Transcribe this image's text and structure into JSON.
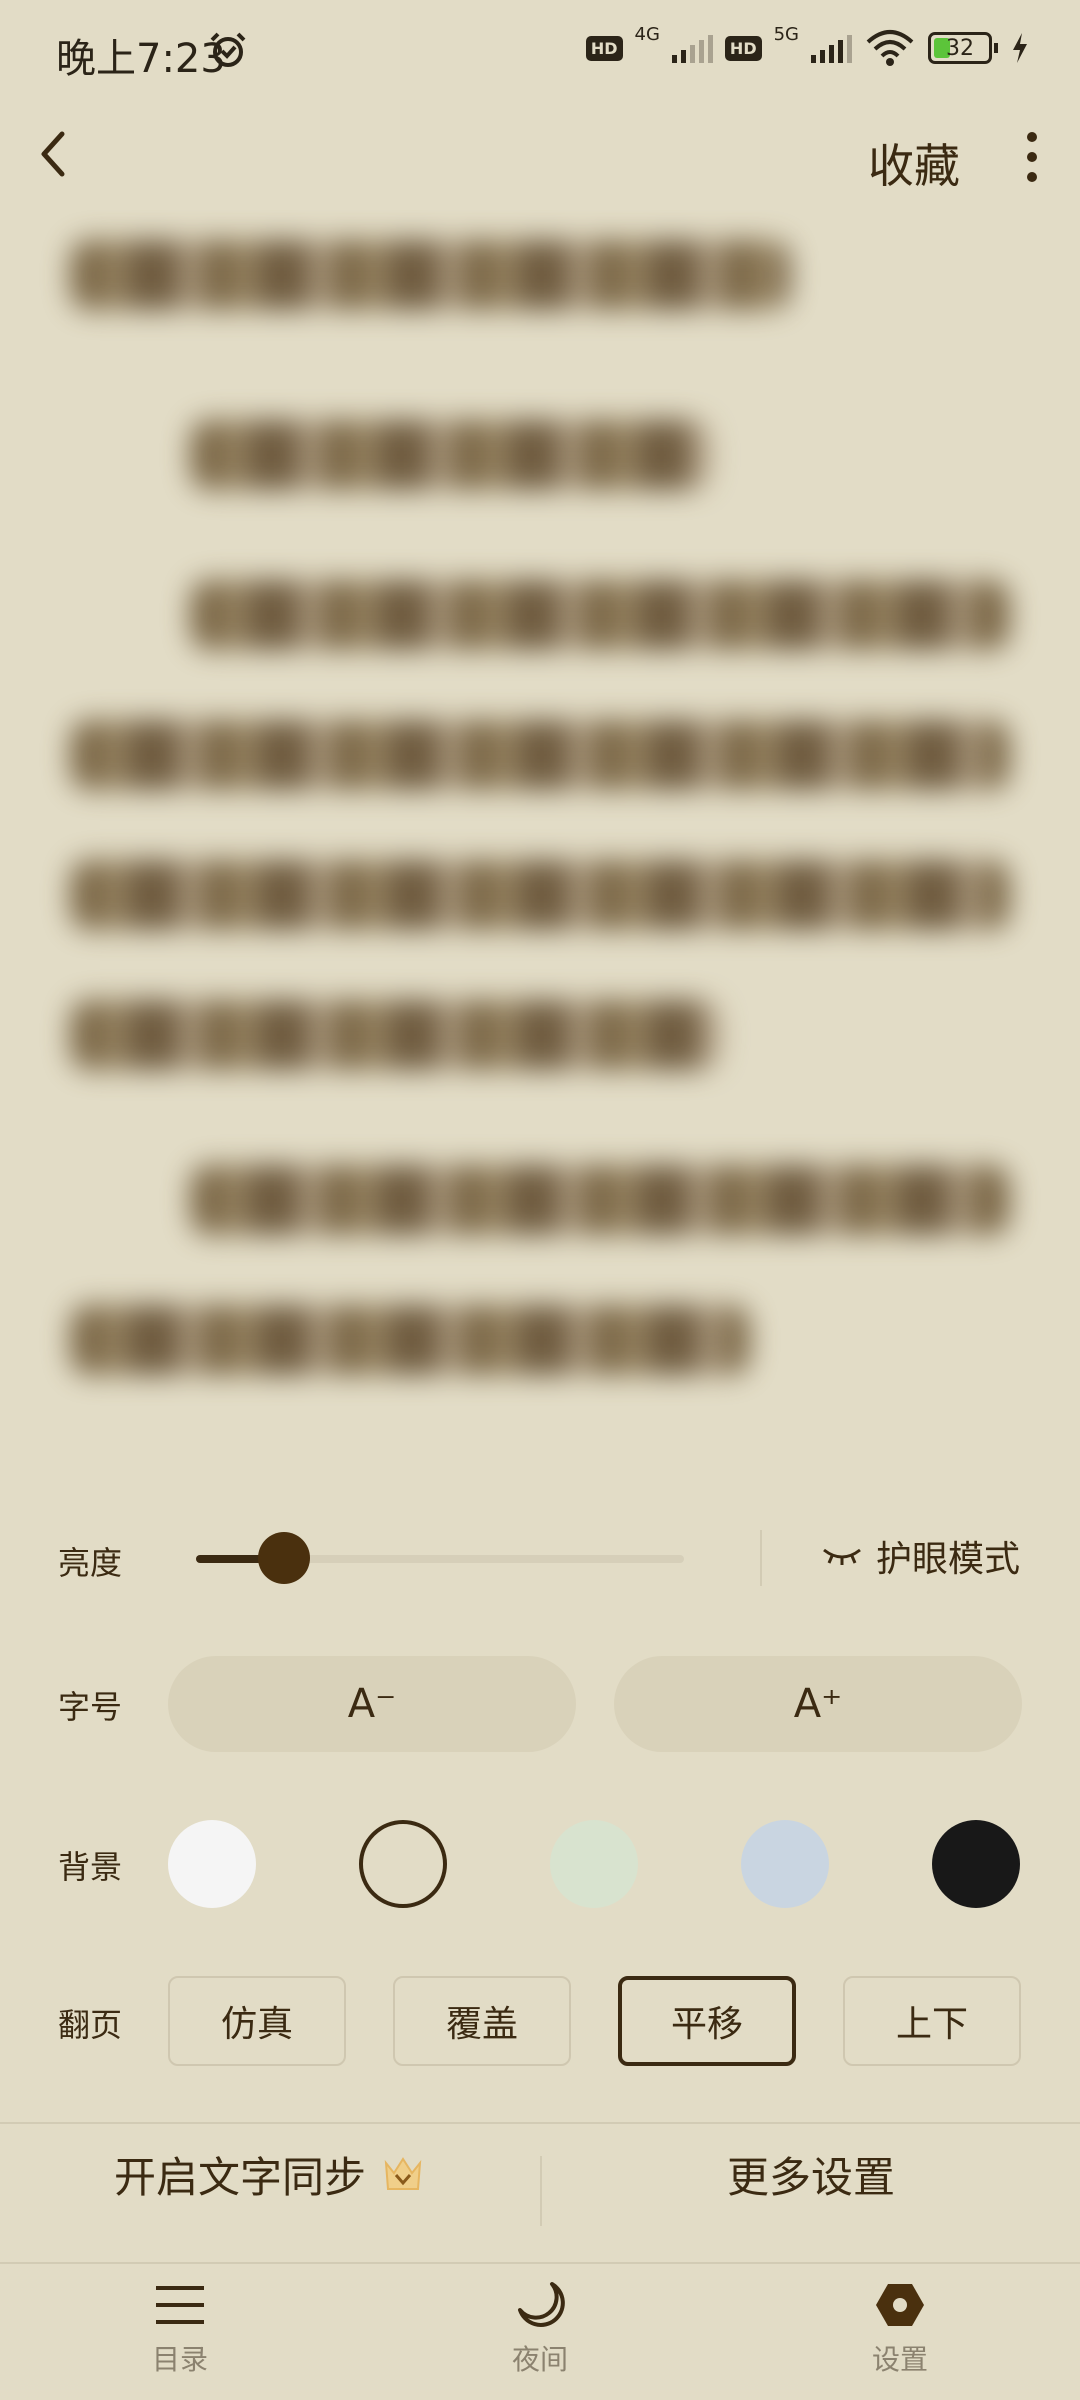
{
  "status_bar": {
    "time": "晚上7:23",
    "hd1": "HD",
    "net1": "4G",
    "hd2": "HD",
    "net2": "5G",
    "battery": "32",
    "icons": [
      "alarm-icon",
      "signal-icon",
      "wifi-icon",
      "battery-icon",
      "charging-icon"
    ]
  },
  "top_bar": {
    "favorite_label": "收藏",
    "icons": [
      "back-arrow-icon",
      "more-vertical-icon"
    ]
  },
  "settings": {
    "brightness": {
      "label": "亮度",
      "level": 0.18
    },
    "eye_mode_label": "护眼模式",
    "font_size": {
      "label": "字号",
      "decrease_label": "A⁻",
      "increase_label": "A⁺"
    },
    "background": {
      "label": "背景",
      "swatches": [
        "#f5f5f5",
        "#e2dcc6",
        "#d8e3cf",
        "#c9d5e1",
        "#181818"
      ],
      "selected_index": 1
    },
    "page_turn": {
      "label": "翻页",
      "options": [
        "仿真",
        "覆盖",
        "平移",
        "上下"
      ],
      "selected_index": 2
    },
    "sync_text_label": "开启文字同步",
    "more_settings_label": "更多设置"
  },
  "bottom_nav": {
    "items": [
      {
        "label": "目录",
        "icon": "menu-icon"
      },
      {
        "label": "夜间",
        "icon": "moon-icon"
      },
      {
        "label": "设置",
        "icon": "settings-icon"
      }
    ]
  },
  "colors": {
    "accent": "#3b2a12",
    "background": "#e2dcc6"
  }
}
